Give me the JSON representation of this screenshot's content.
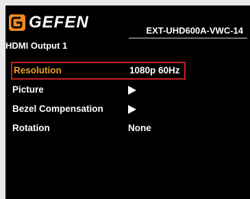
{
  "header": {
    "brand": "GEFEN",
    "model": "EXT-UHD600A-VWC-14"
  },
  "section": {
    "title": "HDMI Output 1"
  },
  "menu": {
    "items": [
      {
        "label": "Resolution",
        "value": "1080p 60Hz",
        "selected": true
      },
      {
        "label": "Picture",
        "value": "",
        "submenu": true
      },
      {
        "label": "Bezel Compensation",
        "value": "",
        "submenu": true
      },
      {
        "label": "Rotation",
        "value": "None"
      }
    ]
  },
  "colors": {
    "background": "#000000",
    "selected_text": "#f2a020",
    "selection_border": "#c81e24",
    "logo_orange": "#f08a1c"
  },
  "icons": {
    "submenu": "triangle-right-icon"
  }
}
